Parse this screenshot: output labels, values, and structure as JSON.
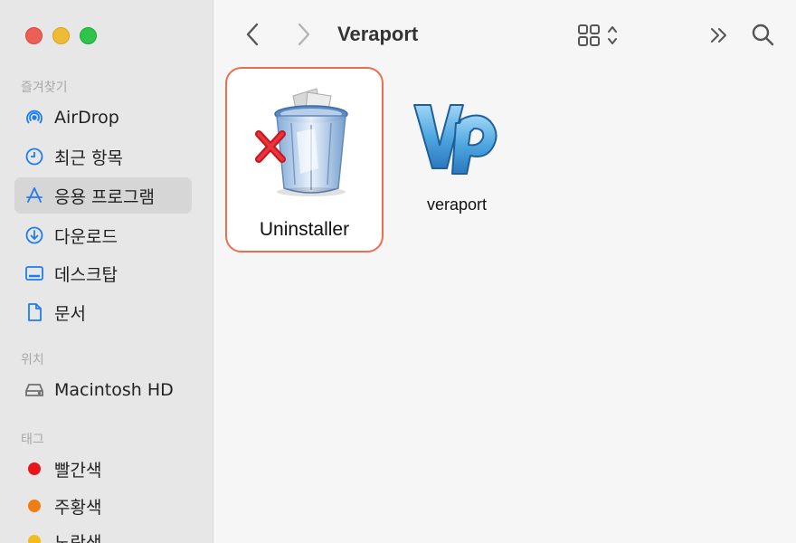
{
  "window": {
    "title": "Veraport"
  },
  "sidebar": {
    "favorites_title": "즐겨찾기",
    "favorites": [
      {
        "label": "AirDrop",
        "icon": "airdrop-icon"
      },
      {
        "label": "최근 항목",
        "icon": "clock-icon"
      },
      {
        "label": "응용 프로그램",
        "icon": "applications-icon",
        "selected": true
      },
      {
        "label": "다운로드",
        "icon": "download-icon"
      },
      {
        "label": "데스크탑",
        "icon": "desktop-icon"
      },
      {
        "label": "문서",
        "icon": "document-icon"
      }
    ],
    "locations_title": "위치",
    "locations": [
      {
        "label": "Macintosh HD",
        "icon": "harddrive-icon"
      }
    ],
    "tags_title": "태그",
    "tags": [
      {
        "label": "빨간색",
        "color": "#e8161b"
      },
      {
        "label": "주황색",
        "color": "#f07d12"
      },
      {
        "label": "노란색",
        "color": "#f2bd18"
      }
    ]
  },
  "files": [
    {
      "label": "Uninstaller",
      "icon": "trash-uninstaller-icon",
      "selected": true
    },
    {
      "label": "veraport",
      "icon": "veraport-logo-icon",
      "selected": false
    }
  ],
  "colors": {
    "accent": "#1f7cf0",
    "selection_border": "#ee6d4e"
  }
}
